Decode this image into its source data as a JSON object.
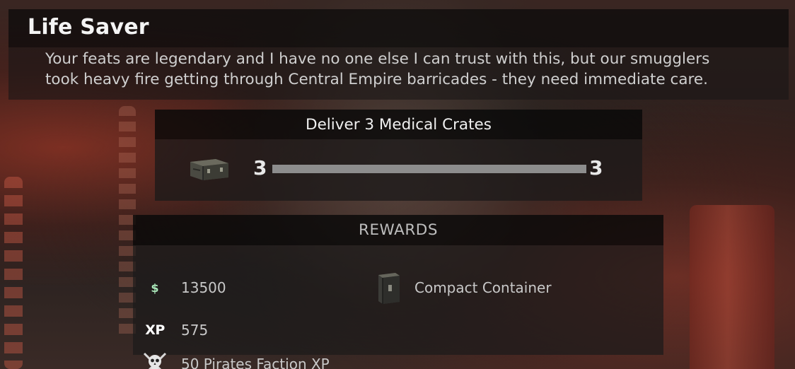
{
  "mission": {
    "title": "Life Saver",
    "description": "Your feats are legendary and I have no one else I can trust with this, but our smugglers\ntook heavy fire getting through Central Empire barricades -  they need immediate care."
  },
  "objective": {
    "title": "Deliver 3 Medical Crates",
    "icon": "medical-crate-icon",
    "current": "3",
    "target": "3",
    "progress_fraction": 1.0
  },
  "rewards": {
    "header": "REWARDS",
    "items": [
      {
        "icon": "money-icon",
        "icon_glyph": "$",
        "text": "13500"
      },
      {
        "icon": "xp-icon",
        "icon_glyph": "XP",
        "text": "575"
      },
      {
        "icon": "pirates-faction-icon",
        "text": "50 Pirates Faction XP"
      },
      {
        "icon": "compact-container-icon",
        "text": "Compact Container"
      }
    ]
  },
  "colors": {
    "money_accent": "#a8e6b8",
    "progress_fill": "#8d8d8d",
    "progress_track": "#3a3a3a"
  }
}
